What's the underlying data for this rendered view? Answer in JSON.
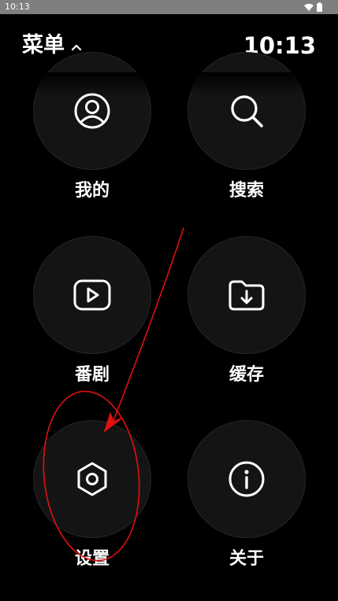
{
  "status_bar": {
    "time": "10:13",
    "icons": [
      "wifi-icon",
      "battery-icon"
    ]
  },
  "header": {
    "title": "菜单",
    "title_icon": "chevron-up-icon",
    "clock": "10:13"
  },
  "menu": {
    "items": [
      {
        "label": "我的",
        "icon": "user-icon"
      },
      {
        "label": "搜索",
        "icon": "search-icon"
      },
      {
        "label": "番剧",
        "icon": "play-icon"
      },
      {
        "label": "缓存",
        "icon": "download-folder-icon"
      },
      {
        "label": "设置",
        "icon": "settings-hexagon-icon"
      },
      {
        "label": "关于",
        "icon": "info-icon"
      }
    ]
  },
  "colors": {
    "background": "#000000",
    "status_bar": "#7f7f7f",
    "circle": "#141414",
    "text": "#ffffff",
    "annotation": "#e01010"
  }
}
